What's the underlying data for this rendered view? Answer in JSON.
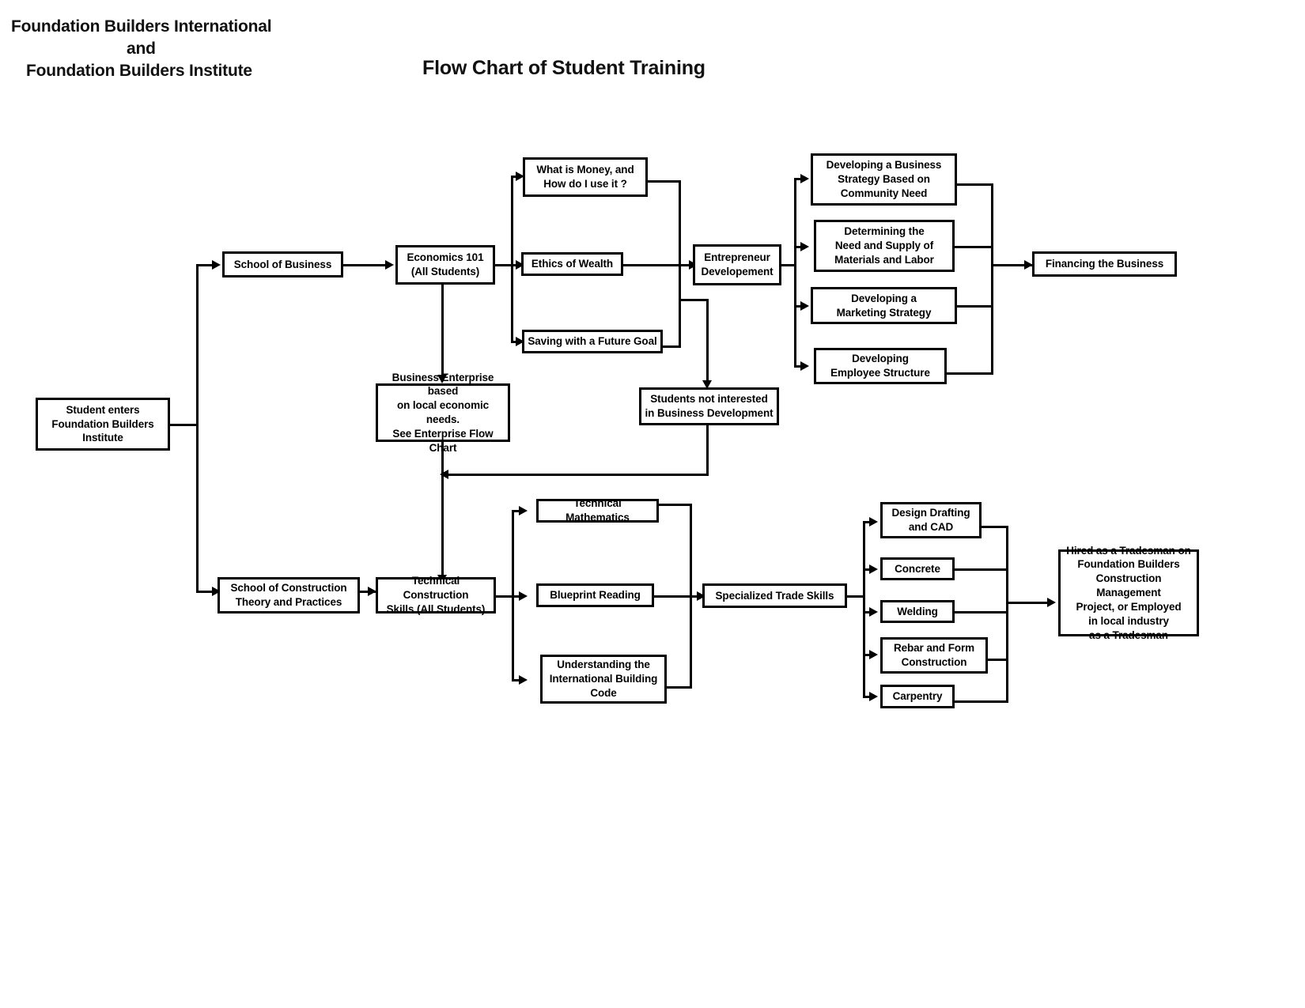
{
  "header": {
    "org_line_1": "Foundation Builders International",
    "org_line_2": "and",
    "org_line_3": "Foundation Builders Institute",
    "title": "Flow Chart of Student Training"
  },
  "chart_data": {
    "type": "diagram",
    "title": "Flow Chart of Student Training",
    "nodes": {
      "start": "Student enters\nFoundation Builders\nInstitute",
      "school_business": "School of Business",
      "economics": "Economics 101\n(All Students)",
      "money": "What is Money, and\nHow do I use it ?",
      "ethics": "Ethics of Wealth",
      "saving": "Saving with a Future Goal",
      "business_enterprise": "Business Enterprise based\non local economic needs.\nSee Enterprise Flow Chart",
      "entrepreneur": "Entrepreneur\nDevelopement",
      "not_interested": "Students not interested\nin Business Development",
      "strategy": "Developing a Business\nStrategy Based on\nCommunity Need",
      "materials": "Determining the\nNeed and Supply of\nMaterials and Labor",
      "marketing": "Developing a\nMarketing Strategy",
      "employee": "Developing\nEmployee Structure",
      "financing": "Financing the Business",
      "school_construction": "School of Construction\nTheory and Practices",
      "tech_construction": "Technical Construction\nSkills  (All Students)",
      "tech_math": "Technical Mathematics",
      "blueprint": "Blueprint Reading",
      "building_code": "Understanding the\nInternational Building\nCode",
      "trade_skills": "Specialized Trade Skills",
      "cad": "Design Drafting\nand CAD",
      "concrete": "Concrete",
      "welding": "Welding",
      "rebar": "Rebar and Form\nConstruction",
      "carpentry": "Carpentry",
      "hired": "Hired as a Tradesman on\nFoundation Builders\nConstruction Management\nProject,  or Employed\nin local industry\nas a Tradesman"
    }
  },
  "boxes": {
    "start": {
      "l1": "Student enters",
      "l2": "Foundation Builders",
      "l3": "Institute"
    },
    "school_business": {
      "l1": "School of Business"
    },
    "economics": {
      "l1": "Economics 101",
      "l2": "(All Students)"
    },
    "money": {
      "l1": "What is Money, and",
      "l2": "How do I use it ?"
    },
    "ethics": {
      "l1": "Ethics of Wealth"
    },
    "saving": {
      "l1": "Saving with a Future Goal"
    },
    "business_enterprise": {
      "l1": "Business Enterprise based",
      "l2": "on local economic needs.",
      "l3": "See Enterprise Flow Chart"
    },
    "entrepreneur": {
      "l1": "Entrepreneur",
      "l2": "Developement"
    },
    "not_interested": {
      "l1": "Students not interested",
      "l2": "in Business Development"
    },
    "strategy": {
      "l1": "Developing a Business",
      "l2": "Strategy Based on",
      "l3": "Community Need"
    },
    "materials": {
      "l1": "Determining the",
      "l2": "Need and Supply of",
      "l3": "Materials and Labor"
    },
    "marketing": {
      "l1": "Developing a",
      "l2": "Marketing Strategy"
    },
    "employee": {
      "l1": "Developing",
      "l2": "Employee Structure"
    },
    "financing": {
      "l1": "Financing the Business"
    },
    "school_construction": {
      "l1": "School of Construction",
      "l2": "Theory and Practices"
    },
    "tech_construction": {
      "l1": "Technical Construction",
      "l2": "Skills  (All Students)"
    },
    "tech_math": {
      "l1": "Technical Mathematics"
    },
    "blueprint": {
      "l1": "Blueprint Reading"
    },
    "building_code": {
      "l1": "Understanding the",
      "l2": "International Building",
      "l3": "Code"
    },
    "trade_skills": {
      "l1": "Specialized Trade Skills"
    },
    "cad": {
      "l1": "Design Drafting",
      "l2": "and CAD"
    },
    "concrete": {
      "l1": "Concrete"
    },
    "welding": {
      "l1": "Welding"
    },
    "rebar": {
      "l1": "Rebar and Form",
      "l2": "Construction"
    },
    "carpentry": {
      "l1": "Carpentry"
    },
    "hired": {
      "l1": "Hired as a Tradesman on",
      "l2": "Foundation Builders",
      "l3": "Construction Management",
      "l4": "Project,  or Employed",
      "l5": "in local industry",
      "l6": "as a Tradesman"
    }
  }
}
